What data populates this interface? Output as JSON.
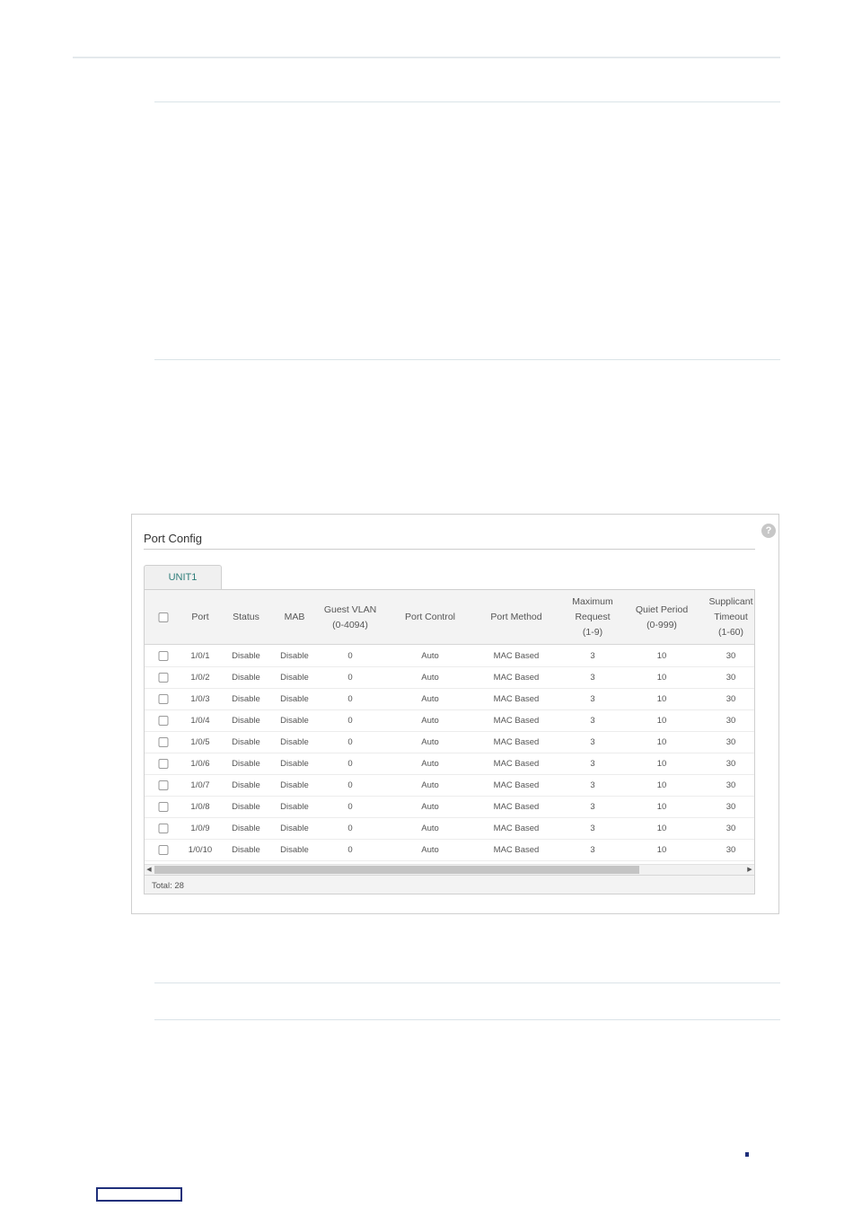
{
  "panel": {
    "title": "Port Config",
    "help_glyph": "?",
    "tab_label": "UNIT1",
    "headers": {
      "port": "Port",
      "status": "Status",
      "mab": "MAB",
      "guest_vlan": [
        "Guest VLAN",
        "(0-4094)"
      ],
      "port_control": "Port Control",
      "port_method": "Port Method",
      "max_request": [
        "Maximum",
        "Request",
        "(1-9)"
      ],
      "quiet_period": [
        "Quiet Period",
        "(0-999)"
      ],
      "supplicant_timeout": [
        "Supplicant",
        "Timeout",
        "(1-60)"
      ]
    },
    "rows": [
      {
        "port": "1/0/1",
        "status": "Disable",
        "mab": "Disable",
        "guest_vlan": "0",
        "port_control": "Auto",
        "port_method": "MAC Based",
        "max_request": "3",
        "quiet_period": "10",
        "supplicant_timeout": "30"
      },
      {
        "port": "1/0/2",
        "status": "Disable",
        "mab": "Disable",
        "guest_vlan": "0",
        "port_control": "Auto",
        "port_method": "MAC Based",
        "max_request": "3",
        "quiet_period": "10",
        "supplicant_timeout": "30"
      },
      {
        "port": "1/0/3",
        "status": "Disable",
        "mab": "Disable",
        "guest_vlan": "0",
        "port_control": "Auto",
        "port_method": "MAC Based",
        "max_request": "3",
        "quiet_period": "10",
        "supplicant_timeout": "30"
      },
      {
        "port": "1/0/4",
        "status": "Disable",
        "mab": "Disable",
        "guest_vlan": "0",
        "port_control": "Auto",
        "port_method": "MAC Based",
        "max_request": "3",
        "quiet_period": "10",
        "supplicant_timeout": "30"
      },
      {
        "port": "1/0/5",
        "status": "Disable",
        "mab": "Disable",
        "guest_vlan": "0",
        "port_control": "Auto",
        "port_method": "MAC Based",
        "max_request": "3",
        "quiet_period": "10",
        "supplicant_timeout": "30"
      },
      {
        "port": "1/0/6",
        "status": "Disable",
        "mab": "Disable",
        "guest_vlan": "0",
        "port_control": "Auto",
        "port_method": "MAC Based",
        "max_request": "3",
        "quiet_period": "10",
        "supplicant_timeout": "30"
      },
      {
        "port": "1/0/7",
        "status": "Disable",
        "mab": "Disable",
        "guest_vlan": "0",
        "port_control": "Auto",
        "port_method": "MAC Based",
        "max_request": "3",
        "quiet_period": "10",
        "supplicant_timeout": "30"
      },
      {
        "port": "1/0/8",
        "status": "Disable",
        "mab": "Disable",
        "guest_vlan": "0",
        "port_control": "Auto",
        "port_method": "MAC Based",
        "max_request": "3",
        "quiet_period": "10",
        "supplicant_timeout": "30"
      },
      {
        "port": "1/0/9",
        "status": "Disable",
        "mab": "Disable",
        "guest_vlan": "0",
        "port_control": "Auto",
        "port_method": "MAC Based",
        "max_request": "3",
        "quiet_period": "10",
        "supplicant_timeout": "30"
      },
      {
        "port": "1/0/10",
        "status": "Disable",
        "mab": "Disable",
        "guest_vlan": "0",
        "port_control": "Auto",
        "port_method": "MAC Based",
        "max_request": "3",
        "quiet_period": "10",
        "supplicant_timeout": "30"
      }
    ],
    "total_label": "Total: 28",
    "scroll_left_glyph": "◀",
    "scroll_right_glyph": "▶"
  },
  "colors": {
    "tab_text": "#2d7c78",
    "nav_accent": "#1f2f7a"
  }
}
